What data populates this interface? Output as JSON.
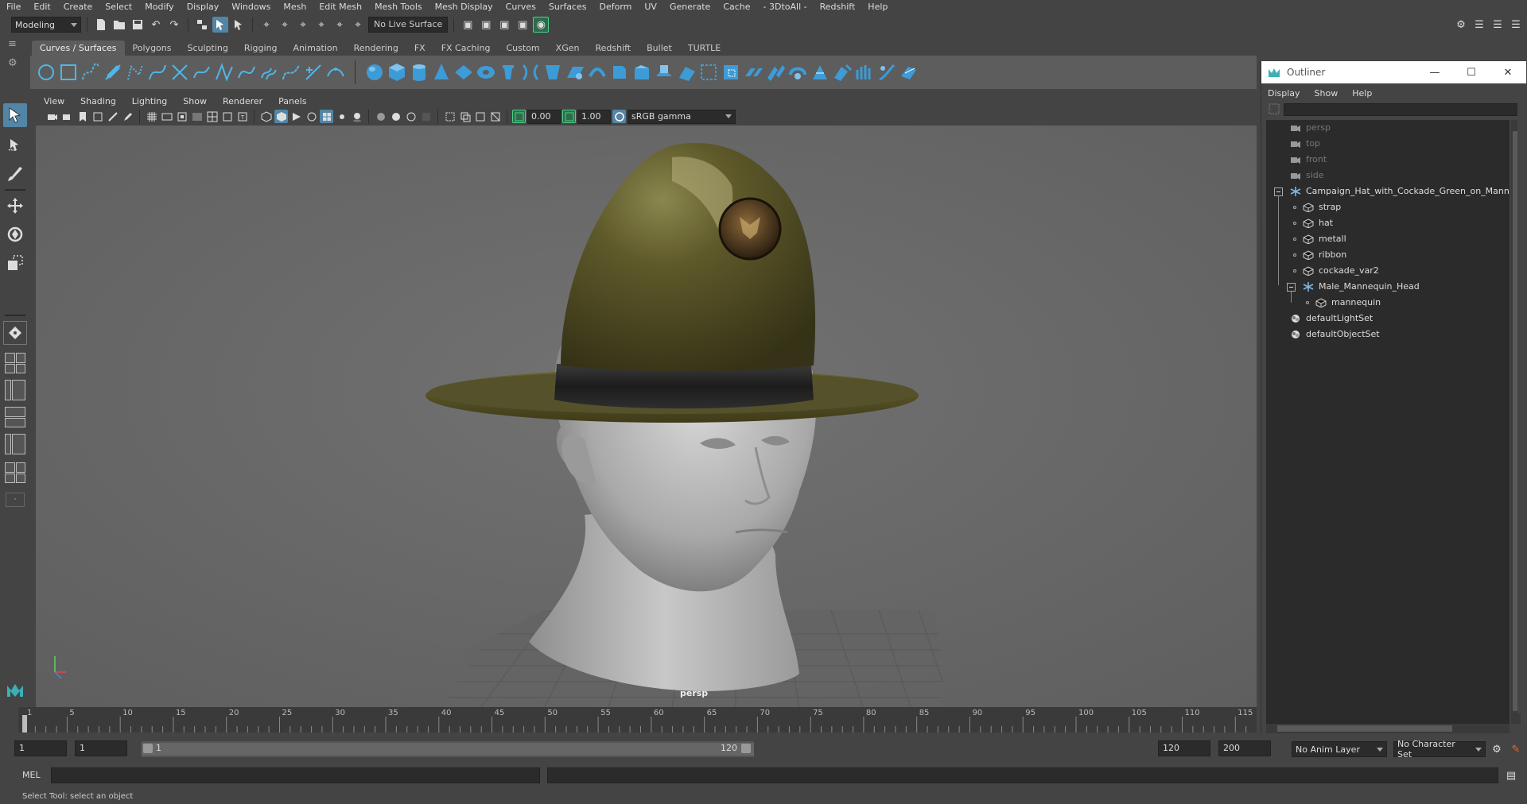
{
  "menubar": [
    "File",
    "Edit",
    "Create",
    "Select",
    "Modify",
    "Display",
    "Windows",
    "Mesh",
    "Edit Mesh",
    "Mesh Tools",
    "Mesh Display",
    "Curves",
    "Surfaces",
    "Deform",
    "UV",
    "Generate",
    "Cache",
    "- 3DtoAll -",
    "Redshift",
    "Help"
  ],
  "status": {
    "menuset": "Modeling",
    "live_surface": "No Live Surface"
  },
  "shelf": {
    "tabs": [
      "Curves / Surfaces",
      "Polygons",
      "Sculpting",
      "Rigging",
      "Animation",
      "Rendering",
      "FX",
      "FX Caching",
      "Custom",
      "XGen",
      "Redshift",
      "Bullet",
      "TURTLE"
    ],
    "active_tab": "Curves / Surfaces"
  },
  "viewport": {
    "menus": [
      "View",
      "Shading",
      "Lighting",
      "Show",
      "Renderer",
      "Panels"
    ],
    "exposure": "0.00",
    "gamma": "1.00",
    "color_space": "sRGB gamma",
    "camera_label": "persp"
  },
  "outliner": {
    "title": "Outliner",
    "menus": [
      "Display",
      "Show",
      "Help"
    ],
    "items": [
      {
        "label": "persp",
        "type": "camera"
      },
      {
        "label": "top",
        "type": "camera"
      },
      {
        "label": "front",
        "type": "camera"
      },
      {
        "label": "side",
        "type": "camera"
      },
      {
        "label": "Campaign_Hat_with_Cockade_Green_on_Mann",
        "type": "group"
      },
      {
        "label": "strap",
        "type": "mesh"
      },
      {
        "label": "hat",
        "type": "mesh"
      },
      {
        "label": "metall",
        "type": "mesh"
      },
      {
        "label": "ribbon",
        "type": "mesh"
      },
      {
        "label": "cockade_var2",
        "type": "mesh"
      },
      {
        "label": "Male_Mannequin_Head",
        "type": "group"
      },
      {
        "label": "mannequin",
        "type": "mesh"
      },
      {
        "label": "defaultLightSet",
        "type": "set"
      },
      {
        "label": "defaultObjectSet",
        "type": "set"
      }
    ]
  },
  "timeline": {
    "ticks": [
      "1",
      "5",
      "10",
      "15",
      "20",
      "25",
      "30",
      "35",
      "40",
      "45",
      "50",
      "55",
      "60",
      "65",
      "70",
      "75",
      "80",
      "85",
      "90",
      "95",
      "100",
      "105",
      "110",
      "115"
    ],
    "current_frame": 1
  },
  "range": {
    "start": "1",
    "playback_start": "1",
    "range_start": "1",
    "range_end": "120",
    "playback_end": "120",
    "end": "200",
    "anim_layer": "No Anim Layer",
    "character_set": "No Character Set"
  },
  "cmdline": {
    "label": "MEL"
  },
  "help_line": "Select Tool: select an object"
}
